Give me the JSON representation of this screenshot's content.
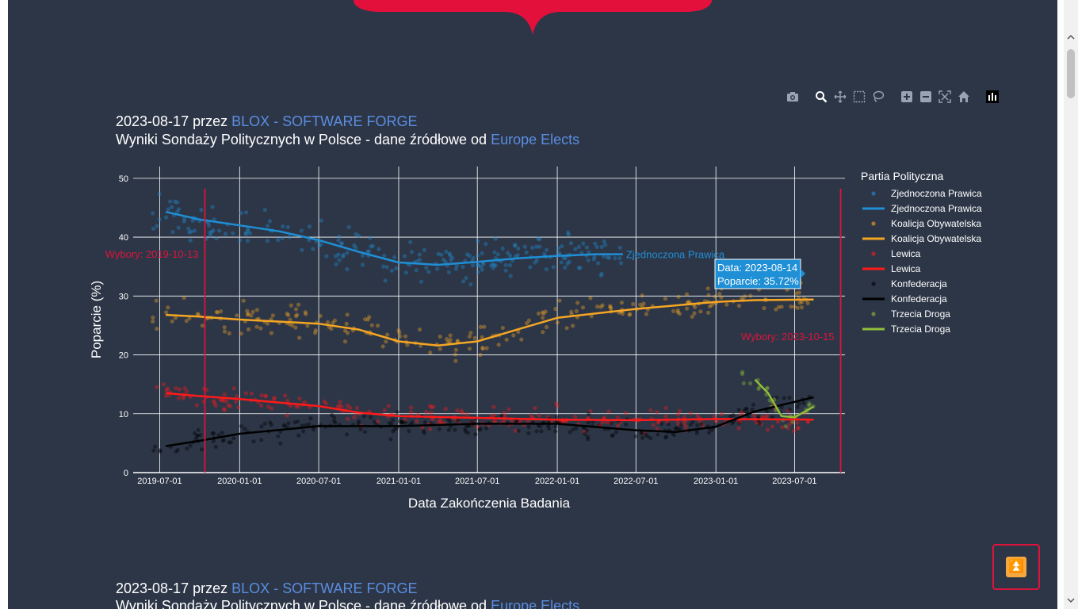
{
  "header": {
    "date": "2023-08-17",
    "by": " przez ",
    "author_link": "BLOX - SOFTWARE FORGE",
    "subtitle_prefix": "Wyniki Sondaży Politycznych w Polsce - dane źródłowe od ",
    "source_link": "Europe Elects"
  },
  "modebar": {
    "icons": [
      "camera-icon",
      "zoom-icon",
      "pan-icon",
      "box-select-icon",
      "lasso-select-icon",
      "zoom-in-icon",
      "zoom-out-icon",
      "autoscale-icon",
      "reset-axes-icon",
      "plotly-logo-icon"
    ]
  },
  "colors": {
    "background": "#2d3647",
    "zp": "#1f8fd6",
    "ko": "#f5a623",
    "lewica": "#ff1a1a",
    "konfederacja": "#000000",
    "trzecia": "#8fbf3a",
    "election": "#dc143c",
    "link": "#5a8de0"
  },
  "chart_data": {
    "type": "line",
    "xlabel": "Data Zakończenia Badania",
    "ylabel": "Poparcie (%)",
    "xlim": [
      "2019-05-01",
      "2023-10-25"
    ],
    "ylim": [
      0,
      52
    ],
    "x_ticks": [
      "2019-07-01",
      "2020-01-01",
      "2020-07-01",
      "2021-01-01",
      "2021-07-01",
      "2022-01-01",
      "2022-07-01",
      "2023-01-01",
      "2023-07-01"
    ],
    "y_ticks": [
      0,
      10,
      20,
      30,
      40,
      50
    ],
    "grid": true,
    "legend_title": "Partia Polityczna",
    "legend_placement": "right",
    "legend": [
      {
        "name": "Zjednoczona Prawica",
        "kind": "markers",
        "color": "#1f8fd6"
      },
      {
        "name": "Zjednoczona Prawica",
        "kind": "line",
        "color": "#1f8fd6"
      },
      {
        "name": "Koalicja Obywatelska",
        "kind": "markers",
        "color": "#f5a623"
      },
      {
        "name": "Koalicja Obywatelska",
        "kind": "line",
        "color": "#f5a623"
      },
      {
        "name": "Lewica",
        "kind": "markers",
        "color": "#ff1a1a"
      },
      {
        "name": "Lewica",
        "kind": "line",
        "color": "#ff1a1a"
      },
      {
        "name": "Konfederacja",
        "kind": "markers",
        "color": "#000000"
      },
      {
        "name": "Konfederacja",
        "kind": "line",
        "color": "#000000"
      },
      {
        "name": "Trzecia Droga",
        "kind": "markers",
        "color": "#8fbf3a"
      },
      {
        "name": "Trzecia Droga",
        "kind": "line",
        "color": "#8fbf3a"
      }
    ],
    "series": [
      {
        "name": "Zjednoczona Prawica",
        "color": "#1f8fd6",
        "x": [
          "2019-07-15",
          "2019-10-01",
          "2020-01-01",
          "2020-04-01",
          "2020-07-01",
          "2020-10-01",
          "2021-01-01",
          "2021-04-01",
          "2021-07-01",
          "2021-10-01",
          "2022-01-01",
          "2022-04-01",
          "2022-06-01"
        ],
        "y": [
          44.3,
          43,
          42,
          41,
          39.5,
          37.5,
          35.7,
          35.3,
          35.8,
          36.4,
          36.8,
          37.1,
          37.1
        ],
        "spread": 3
      },
      {
        "name": "Koalicja Obywatelska",
        "color": "#f5a623",
        "x": [
          "2019-07-15",
          "2019-10-01",
          "2020-01-01",
          "2020-07-01",
          "2020-10-01",
          "2021-01-01",
          "2021-04-01",
          "2021-07-01",
          "2021-10-01",
          "2022-01-01",
          "2022-07-01",
          "2023-01-01",
          "2023-04-01",
          "2023-08-14"
        ],
        "y": [
          26.8,
          26.5,
          26,
          25.3,
          24.3,
          22.3,
          21.6,
          22.3,
          24.3,
          26.3,
          27.8,
          29,
          29.3,
          29.4
        ],
        "spread": 2.5
      },
      {
        "name": "Lewica",
        "color": "#ff1a1a",
        "x": [
          "2019-07-15",
          "2019-10-01",
          "2020-01-01",
          "2020-07-01",
          "2020-10-01",
          "2021-01-01",
          "2021-07-01",
          "2022-01-01",
          "2022-07-01",
          "2023-01-01",
          "2023-08-14"
        ],
        "y": [
          13.5,
          13,
          12.5,
          11.3,
          10.2,
          9.6,
          9.3,
          9.0,
          8.9,
          9.1,
          9.0
        ],
        "spread": 2
      },
      {
        "name": "Konfederacja",
        "color": "#000000",
        "x": [
          "2019-07-15",
          "2019-10-01",
          "2020-01-01",
          "2020-07-01",
          "2021-01-01",
          "2021-07-01",
          "2022-01-01",
          "2022-07-01",
          "2022-10-01",
          "2023-01-01",
          "2023-04-01",
          "2023-08-14"
        ],
        "y": [
          4.5,
          5.4,
          6.6,
          7.9,
          7.9,
          8.3,
          8.3,
          7.2,
          6.9,
          7.8,
          10.4,
          12.8
        ],
        "spread": 1.8
      },
      {
        "name": "Trzecia Droga",
        "color": "#8fbf3a",
        "x": [
          "2023-04-01",
          "2023-05-01",
          "2023-06-01",
          "2023-07-01",
          "2023-08-14"
        ],
        "y": [
          15.8,
          13.5,
          9.6,
          9.4,
          11.2
        ],
        "spread": 1.5
      }
    ],
    "elections": [
      {
        "date": "2019-10-13",
        "label": "Wybory: 2019-10-13"
      },
      {
        "date": "2023-10-15",
        "label": "Wybory: 2023-10-15"
      }
    ],
    "end_label": {
      "text": "Zjednoczona Prawica"
    },
    "tooltip": {
      "date_line": "Data: 2023-08-14",
      "value_line": "Poparcie: 35.72%"
    }
  },
  "scroll_top_button": {
    "label": "⏫"
  }
}
